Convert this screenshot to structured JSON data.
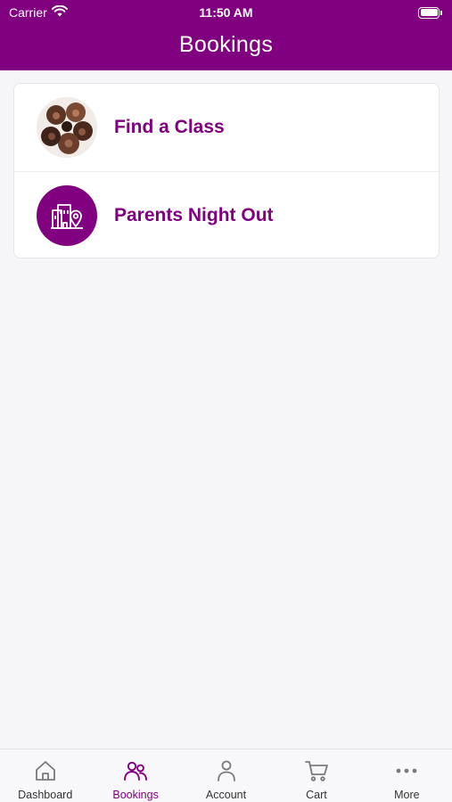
{
  "status_bar": {
    "carrier": "Carrier",
    "time": "11:50 AM"
  },
  "header": {
    "title": "Bookings"
  },
  "colors": {
    "brand": "#800080",
    "background": "#f6f6f8",
    "tab_inactive": "#7a7a7a"
  },
  "menu": {
    "items": [
      {
        "label": "Find a Class",
        "icon": "group-photo"
      },
      {
        "label": "Parents Night Out",
        "icon": "building-location-icon"
      }
    ]
  },
  "tabbar": {
    "active": "Bookings",
    "tabs": [
      {
        "label": "Dashboard",
        "icon": "home-icon"
      },
      {
        "label": "Bookings",
        "icon": "people-icon"
      },
      {
        "label": "Account",
        "icon": "person-icon"
      },
      {
        "label": "Cart",
        "icon": "cart-icon"
      },
      {
        "label": "More",
        "icon": "more-icon"
      }
    ]
  }
}
